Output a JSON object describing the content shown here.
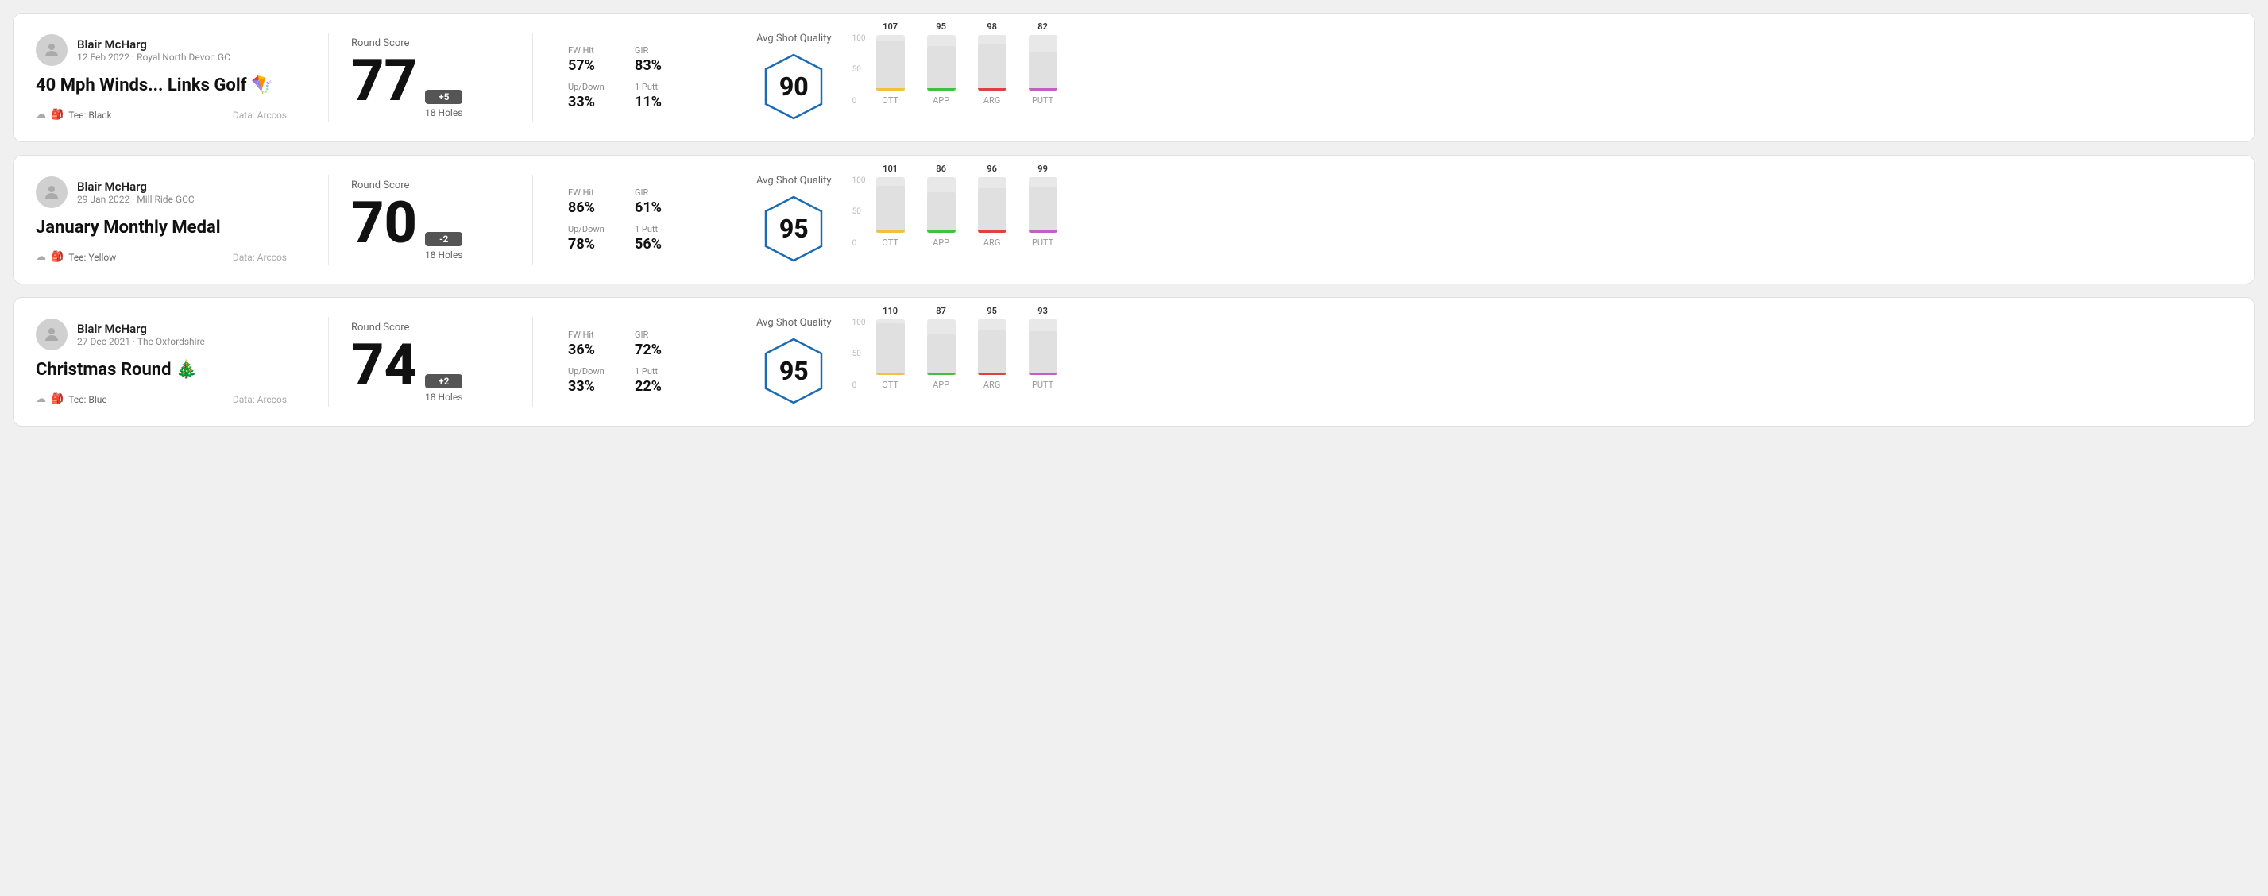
{
  "rounds": [
    {
      "user_name": "Blair McHarg",
      "user_date": "12 Feb 2022 · Royal North Devon GC",
      "round_title": "40 Mph Winds... Links Golf 🪁",
      "tee": "Tee: Black",
      "data_source": "Data: Arccos",
      "score": "77",
      "score_diff": "+5",
      "holes": "18 Holes",
      "fw_hit_label": "FW Hit",
      "fw_hit_value": "57%",
      "gir_label": "GIR",
      "gir_value": "83%",
      "updown_label": "Up/Down",
      "updown_value": "33%",
      "oneputt_label": "1 Putt",
      "oneputt_value": "11%",
      "avg_shot_label": "Avg Shot Quality",
      "quality_score": "90",
      "bars": [
        {
          "label": "OTT",
          "value": 107,
          "color": "#f0c040"
        },
        {
          "label": "APP",
          "value": 95,
          "color": "#40c040"
        },
        {
          "label": "ARG",
          "value": 98,
          "color": "#e04040"
        },
        {
          "label": "PUTT",
          "value": 82,
          "color": "#c060c0"
        }
      ]
    },
    {
      "user_name": "Blair McHarg",
      "user_date": "29 Jan 2022 · Mill Ride GCC",
      "round_title": "January Monthly Medal",
      "tee": "Tee: Yellow",
      "data_source": "Data: Arccos",
      "score": "70",
      "score_diff": "-2",
      "holes": "18 Holes",
      "fw_hit_label": "FW Hit",
      "fw_hit_value": "86%",
      "gir_label": "GIR",
      "gir_value": "61%",
      "updown_label": "Up/Down",
      "updown_value": "78%",
      "oneputt_label": "1 Putt",
      "oneputt_value": "56%",
      "avg_shot_label": "Avg Shot Quality",
      "quality_score": "95",
      "bars": [
        {
          "label": "OTT",
          "value": 101,
          "color": "#f0c040"
        },
        {
          "label": "APP",
          "value": 86,
          "color": "#40c040"
        },
        {
          "label": "ARG",
          "value": 96,
          "color": "#e04040"
        },
        {
          "label": "PUTT",
          "value": 99,
          "color": "#c060c0"
        }
      ]
    },
    {
      "user_name": "Blair McHarg",
      "user_date": "27 Dec 2021 · The Oxfordshire",
      "round_title": "Christmas Round 🎄",
      "tee": "Tee: Blue",
      "data_source": "Data: Arccos",
      "score": "74",
      "score_diff": "+2",
      "holes": "18 Holes",
      "fw_hit_label": "FW Hit",
      "fw_hit_value": "36%",
      "gir_label": "GIR",
      "gir_value": "72%",
      "updown_label": "Up/Down",
      "updown_value": "33%",
      "oneputt_label": "1 Putt",
      "oneputt_value": "22%",
      "avg_shot_label": "Avg Shot Quality",
      "quality_score": "95",
      "bars": [
        {
          "label": "OTT",
          "value": 110,
          "color": "#f0c040"
        },
        {
          "label": "APP",
          "value": 87,
          "color": "#40c040"
        },
        {
          "label": "ARG",
          "value": 95,
          "color": "#e04040"
        },
        {
          "label": "PUTT",
          "value": 93,
          "color": "#c060c0"
        }
      ]
    }
  ],
  "chart_y_labels": [
    "100",
    "50",
    "0"
  ]
}
